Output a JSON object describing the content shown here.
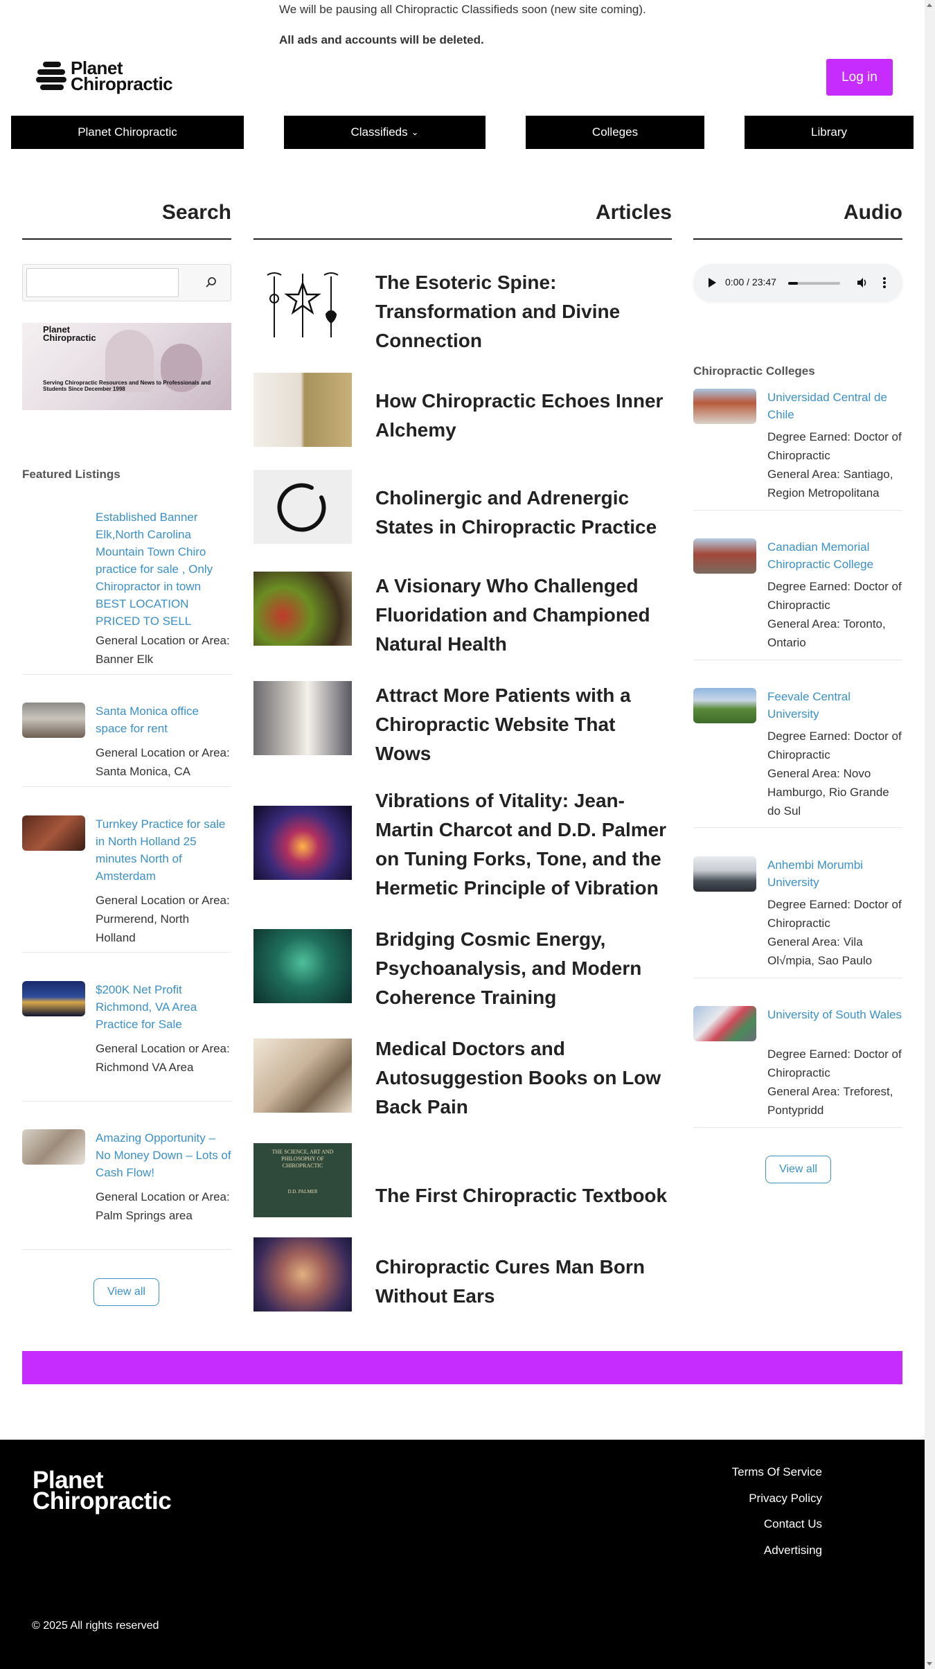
{
  "notice": {
    "line1": "We will be pausing all Chiropractic Classifieds soon (new site coming).",
    "line2": "All ads and accounts will be deleted."
  },
  "header": {
    "logo_line1": "Planet",
    "logo_line2": "Chiropractic",
    "login_label": "Log in"
  },
  "nav": {
    "items": [
      "Planet Chiropractic",
      "Classifieds",
      "Colleges",
      "Library"
    ],
    "dropdown_glyph": "⌄"
  },
  "columns": {
    "search": "Search",
    "articles": "Articles",
    "audio": "Audio"
  },
  "banner": {
    "title_line1": "Planet",
    "title_line2": "Chiropractic",
    "subtitle": "Serving Chiropractic Resources and News to Professionals and Students Since December 1998"
  },
  "featured": {
    "heading": "Featured Listings",
    "view_all": "View all",
    "items": [
      {
        "title": "Established Banner Elk,North Carolina Mountain Town Chiro practice for sale , Only Chiropractor in town BEST LOCATION PRICED TO SELL",
        "location": "General Location or Area: Banner Elk"
      },
      {
        "title": "Santa Monica office space for rent",
        "location": "General Location or Area: Santa Monica, CA"
      },
      {
        "title": "Turnkey Practice for sale in North Holland 25 minutes North of Amsterdam",
        "location": "General Location or Area: Purmerend, North Holland"
      },
      {
        "title": "$200K Net Profit Richmond, VA Area Practice for Sale",
        "location": "General Location or Area: Richmond VA Area"
      },
      {
        "title": "Amazing Opportunity – No Money Down – Lots of Cash Flow!",
        "location": "General Location or Area: Palm Springs area"
      }
    ]
  },
  "articles": [
    {
      "title": "The Esoteric Spine: Transformation and Divine Connection"
    },
    {
      "title": "How Chiropractic Echoes Inner Alchemy"
    },
    {
      "title": "Cholinergic and Adrenergic States in Chiropractic Practice"
    },
    {
      "title": "A Visionary Who Challenged Fluoridation and Championed Natural Health"
    },
    {
      "title": "Attract More Patients with a Chiropractic Website That Wows"
    },
    {
      "title": "Vibrations of Vitality: Jean-Martin Charcot and D.D. Palmer on Tuning Forks, Tone, and the Hermetic Principle of Vibration"
    },
    {
      "title": "Bridging Cosmic Energy, Psychoanalysis, and Modern Coherence Training"
    },
    {
      "title": "Medical Doctors and Autosuggestion Books on Low Back Pain"
    },
    {
      "title": "The First Chiropractic Textbook",
      "cover_text": "THE SCIENCE, ART AND PHILOSOPHY OF CHIROPRACTIC",
      "cover_author": "D.D. PALMER"
    },
    {
      "title": "Chiropractic Cures Man Born Without Ears"
    }
  ],
  "audio": {
    "time": "0:00 / 23:47",
    "progress": 0.0
  },
  "colleges": {
    "heading": "Chiropractic Colleges",
    "view_all": "View all",
    "items": [
      {
        "name": "Universidad Central de Chile",
        "degree": "Degree Earned: Doctor of Chiropractic",
        "area": "General Area: Santiago, Region Metropolitana"
      },
      {
        "name": "Canadian Memorial Chiropractic College",
        "degree": "Degree Earned: Doctor of Chiropractic",
        "area": "General Area: Toronto, Ontario"
      },
      {
        "name": "Feevale Central University",
        "degree": "Degree Earned: Doctor of Chiropractic",
        "area": "General Area: Novo Hamburgo, Rio Grande do Sul"
      },
      {
        "name": "Anhembi Morumbi University",
        "degree": "Degree Earned: Doctor of Chiropractic",
        "area": "General Area: Vila Ol√mpia, Sao Paulo"
      },
      {
        "name": "University of South Wales",
        "degree": "Degree Earned: Doctor of Chiropractic",
        "area": "General Area: Treforest, Pontypridd"
      }
    ]
  },
  "footer": {
    "logo_line1": "Planet",
    "logo_line2": "Chiropractic",
    "links": [
      "Terms Of Service",
      "Privacy Policy",
      "Contact Us",
      "Advertising"
    ],
    "copyright": "© 2025 All rights reserved"
  },
  "colors": {
    "accent": "#c72cff",
    "link": "#3a90c8",
    "nav_bg": "#000000"
  }
}
